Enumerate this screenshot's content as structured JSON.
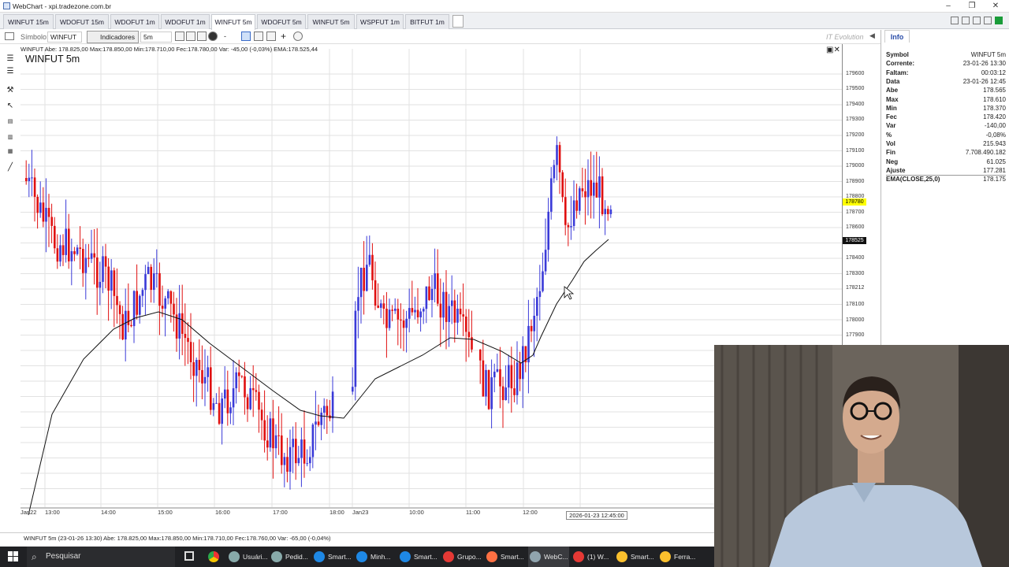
{
  "window": {
    "title": "WebChart - xpi.tradezone.com.br"
  },
  "tabs": [
    "WINFUT 15m",
    "WDOFUT 15m",
    "WDOFUT 1m",
    "WDOFUT 1m",
    "WINFUT 5m",
    "WDOFUT 5m",
    "WINFUT 5m",
    "WSPFUT 1m",
    "BITFUT 1m"
  ],
  "toolbar": {
    "symbol_label": "Símbolo:",
    "symbol_value": "WINFUT",
    "indicators_label": "Indicadores",
    "timeframe": "5m",
    "dash": "-",
    "brand": "IT Evolution"
  },
  "chart": {
    "ohlc_line": "WINFUT Abe: 178.825,00  Max:178.850,00  Min:178.710,00  Fec:178.780,00  Var: -45,00 (-0,03%)  EMA:178.525,44",
    "title": "WINFUT 5m",
    "price_ticks": [
      "179600",
      "179500",
      "179400",
      "179300",
      "179200",
      "179100",
      "179000",
      "178900",
      "178800",
      "178700",
      "178600",
      "178500",
      "178400",
      "178300",
      "178212",
      "178100",
      "178000",
      "177900"
    ],
    "last_price_label": "178780",
    "ema_label": "178525",
    "time_ticks": [
      "Jan22",
      "13:00",
      "14:00",
      "15:00",
      "16:00",
      "17:00",
      "18:00",
      "Jan23",
      "10:00",
      "11:00",
      "12:00"
    ],
    "crosshair_date": "2026-01-23 12:45:00",
    "status_line": "WINFUT 5m  (23-01-26 13:30)  Abe: 178.825,00  Max:178.850,00  Min:178.710,00  Fec:178.760,00  Var: -65,00 (-0,04%)",
    "colors": {
      "up": "#3a3ad8",
      "down": "#e01010",
      "ema": "#111111",
      "grid": "#e2e2e2",
      "last_price": "#ffff00"
    }
  },
  "info_panel": {
    "tab_label": "Info",
    "rows": [
      {
        "k": "Symbol",
        "v": "WINFUT 5m"
      },
      {
        "k": "Corrente:",
        "v": "23-01-26 13:30"
      },
      {
        "k": "Faltam:",
        "v": "00:03:12"
      },
      {
        "k": "Data",
        "v": "23-01-26 12:45"
      },
      {
        "k": "Abe",
        "v": "178.565"
      },
      {
        "k": "Max",
        "v": "178.610"
      },
      {
        "k": "Min",
        "v": "178.370"
      },
      {
        "k": "Fec",
        "v": "178.420"
      },
      {
        "k": "Var",
        "v": "-140,00"
      },
      {
        "k": "%",
        "v": "-0,08%"
      },
      {
        "k": "Vol",
        "v": "215.943"
      },
      {
        "k": "Fin",
        "v": "7.708.490.182"
      },
      {
        "k": "Neg",
        "v": "61.025"
      },
      {
        "k": "Ajuste",
        "v": "177.281"
      },
      {
        "k": "EMA(CLOSE,25,0)",
        "v": "178.175"
      }
    ]
  },
  "taskbar": {
    "search_placeholder": "Pesquisar",
    "apps": [
      "Usuári...",
      "Pedid...",
      "Smart...",
      "Minh...",
      "Smart...",
      "Grupo...",
      "Smart...",
      "WebC...",
      "(1) W...",
      "Smart...",
      "Ferra..."
    ]
  }
}
